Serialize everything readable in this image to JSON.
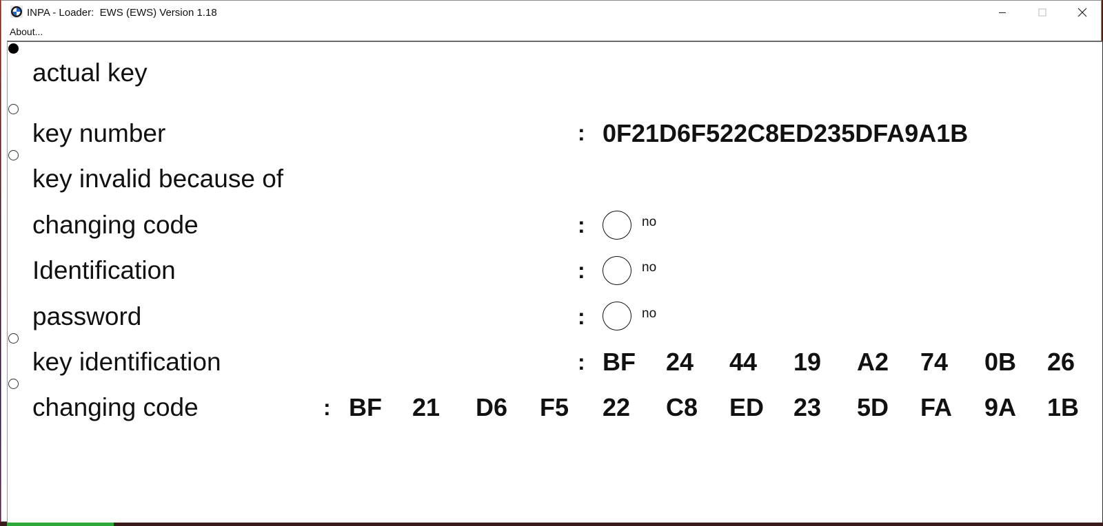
{
  "window": {
    "title": "INPA - Loader:  EWS (EWS) Version 1.18",
    "menu": [
      "About..."
    ]
  },
  "rows": {
    "actual_key": "actual key",
    "key_number": {
      "label": "key number",
      "value": "0F21D6F522C8ED235DFA9A1B"
    },
    "key_invalid": "key invalid because of",
    "changing_code": {
      "label": "changing code",
      "state": "no"
    },
    "identification": {
      "label": "Identification",
      "state": "no"
    },
    "password": {
      "label": "password",
      "state": "no"
    },
    "key_identification": {
      "label": "key identification",
      "bytes": [
        "BF",
        "24",
        "44",
        "19",
        "A2",
        "74",
        "0B",
        "26"
      ]
    },
    "changing_code_bytes": {
      "label": "changing code",
      "bytes": [
        "BF",
        "21",
        "D6",
        "F5",
        "22",
        "C8",
        "ED",
        "23",
        "5D",
        "FA",
        "9A",
        "1B"
      ]
    }
  },
  "separator": ":",
  "colors": {
    "window_bg": "#ffffff",
    "text": "#111111",
    "desktop": "#5a1d14",
    "taskbar_accent": "#2fa83a"
  }
}
